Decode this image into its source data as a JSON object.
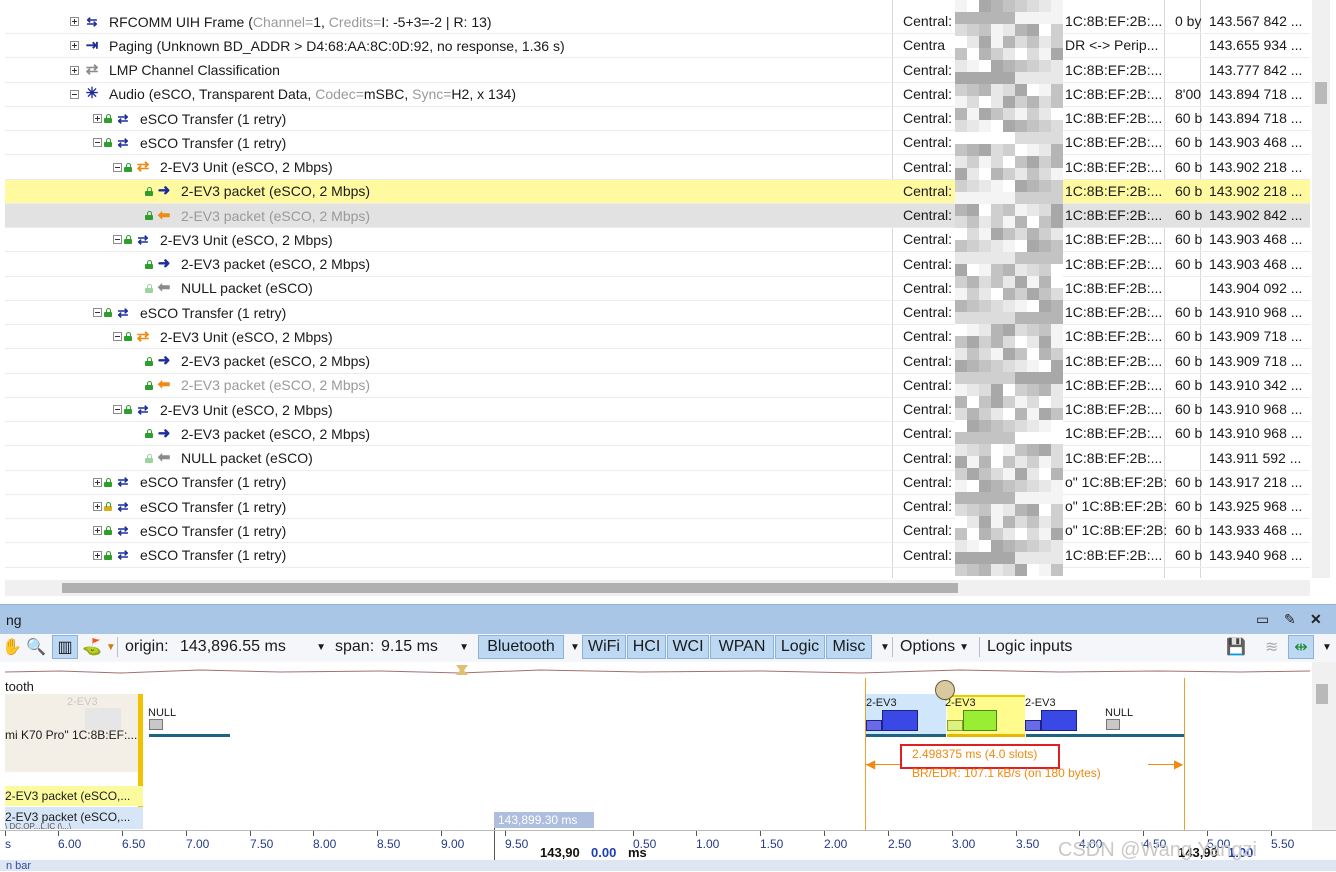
{
  "packet_rows": [
    {
      "indent": 0,
      "expander": "plus",
      "icon": "rfcomm-icon",
      "icon_glyph": "⇆",
      "icon_class": "wide swap",
      "segments": [
        {
          "t": "RFCOMM UIH Frame ("
        },
        {
          "t": "Channel=",
          "faint": true
        },
        {
          "t": "1, "
        },
        {
          "t": "Credits=",
          "faint": true
        },
        {
          "t": "I: -5+3=-2 | R: 13)"
        }
      ],
      "src": "Central:",
      "dst": "1C:8B:EF:2B:...",
      "len": "0 by",
      "time": "143.567 842 ..."
    },
    {
      "indent": 0,
      "expander": "plus",
      "icon": "paging-icon",
      "icon_glyph": "⇥",
      "icon_class": "wide blue",
      "segments": [
        {
          "t": "Paging (Unknown BD_ADDR > D4:68:AA:8C:0D:92, no response, 1.36 s)"
        }
      ],
      "src": "Centra",
      "dst": "DR <-> Perip...",
      "len": "",
      "time": "143.655 934 ..."
    },
    {
      "indent": 0,
      "expander": "plus",
      "icon": "lmp-icon",
      "icon_glyph": "⇄",
      "icon_class": "wide grey",
      "segments": [
        {
          "t": "LMP Channel Classification"
        }
      ],
      "src": "Central:",
      "dst": "1C:8B:EF:2B:...",
      "len": "",
      "time": "143.777 842 ..."
    },
    {
      "indent": 0,
      "expander": "minus",
      "icon": "audio-icon",
      "icon_glyph": "✳",
      "icon_class": "wide blue",
      "segments": [
        {
          "t": "Audio (eSCO, Transparent Data, "
        },
        {
          "t": "Codec=",
          "faint": true
        },
        {
          "t": "mSBC, "
        },
        {
          "t": "Sync=",
          "faint": true
        },
        {
          "t": "H2, x 134)"
        }
      ],
      "src": "Central:",
      "dst": "1C:8B:EF:2B:...",
      "len": "8'00",
      "time": "143.894 718 ..."
    },
    {
      "indent": 1,
      "expander": "plus",
      "lock": "green",
      "icon": "esco-transfer-icon",
      "icon_glyph": "⇄",
      "icon_class": "swap",
      "segments": [
        {
          "t": "eSCO Transfer (1 retry)"
        }
      ],
      "src": "Central:",
      "dst": "1C:8B:EF:2B:...",
      "len": "60 b",
      "time": "143.894 718 ..."
    },
    {
      "indent": 1,
      "expander": "minus",
      "lock": "green",
      "icon": "esco-transfer-icon",
      "icon_glyph": "⇄",
      "icon_class": "swap",
      "segments": [
        {
          "t": "eSCO Transfer (1 retry)"
        }
      ],
      "src": "Central:",
      "dst": "1C:8B:EF:2B:...",
      "len": "60 b",
      "time": "143.903 468 ..."
    },
    {
      "indent": 2,
      "expander": "minus",
      "lock": "green",
      "icon": "unit-icon",
      "icon_glyph": "⇄",
      "icon_class": "orange",
      "segments": [
        {
          "t": "2-EV3 Unit (eSCO, 2 Mbps)"
        }
      ],
      "src": "Central:",
      "dst": "1C:8B:EF:2B:...",
      "len": "60 b",
      "time": "143.902 218 ..."
    },
    {
      "indent": 3,
      "expander": "none",
      "lock": "green",
      "icon": "arrow-right-icon",
      "icon_glyph": "➜",
      "icon_class": "blue",
      "selected": true,
      "segments": [
        {
          "t": "2-EV3 packet (eSCO, 2 Mbps)"
        }
      ],
      "src": "Central:",
      "dst": "1C:8B:EF:2B:...",
      "len": "60 b",
      "time": "143.902 218 ..."
    },
    {
      "indent": 3,
      "expander": "none",
      "lock": "green",
      "icon": "arrow-left-icon",
      "icon_glyph": "⬅",
      "icon_class": "orange",
      "dim": true,
      "segments": [
        {
          "t": "2-EV3 packet (eSCO, 2 Mbps)"
        }
      ],
      "src": "Central:",
      "dst": "1C:8B:EF:2B:...",
      "len": "60 b",
      "time": "143.902 842 ..."
    },
    {
      "indent": 2,
      "expander": "minus",
      "lock": "green",
      "icon": "unit-icon",
      "icon_glyph": "⇄",
      "icon_class": "swap",
      "segments": [
        {
          "t": "2-EV3 Unit (eSCO, 2 Mbps)"
        }
      ],
      "src": "Central:",
      "dst": "1C:8B:EF:2B:...",
      "len": "60 b",
      "time": "143.903 468 ..."
    },
    {
      "indent": 3,
      "expander": "none",
      "lock": "green",
      "icon": "arrow-right-icon",
      "icon_glyph": "➜",
      "icon_class": "blue",
      "segments": [
        {
          "t": "2-EV3 packet (eSCO, 2 Mbps)"
        }
      ],
      "src": "Central:",
      "dst": "1C:8B:EF:2B:...",
      "len": "60 b",
      "time": "143.903 468 ..."
    },
    {
      "indent": 3,
      "expander": "none",
      "lock": "pale",
      "icon": "arrow-left-grey-icon",
      "icon_glyph": "⬅",
      "icon_class": "grey",
      "segments": [
        {
          "t": "NULL packet (eSCO)"
        }
      ],
      "src": "Central:",
      "dst": "1C:8B:EF:2B:...",
      "len": "",
      "time": "143.904 092 ..."
    },
    {
      "indent": 1,
      "expander": "minus",
      "lock": "green",
      "icon": "esco-transfer-icon",
      "icon_glyph": "⇄",
      "icon_class": "swap",
      "segments": [
        {
          "t": "eSCO Transfer (1 retry)"
        }
      ],
      "src": "Central:",
      "dst": "1C:8B:EF:2B:...",
      "len": "60 b",
      "time": "143.910 968 ..."
    },
    {
      "indent": 2,
      "expander": "minus",
      "lock": "green",
      "icon": "unit-icon",
      "icon_glyph": "⇄",
      "icon_class": "orange",
      "segments": [
        {
          "t": "2-EV3 Unit (eSCO, 2 Mbps)"
        }
      ],
      "src": "Central: \"",
      "dst": "1C:8B:EF:2B:...",
      "len": "60 b",
      "time": "143.909 718 ..."
    },
    {
      "indent": 3,
      "expander": "none",
      "lock": "green",
      "icon": "arrow-right-icon",
      "icon_glyph": "➜",
      "icon_class": "blue",
      "segments": [
        {
          "t": "2-EV3 packet (eSCO, 2 Mbps)"
        }
      ],
      "src": "Central: \"",
      "dst": "1C:8B:EF:2B:...",
      "len": "60 b",
      "time": "143.909 718 ..."
    },
    {
      "indent": 3,
      "expander": "none",
      "lock": "green",
      "icon": "arrow-left-icon",
      "icon_glyph": "⬅",
      "icon_class": "orange",
      "greytext": true,
      "segments": [
        {
          "t": "2-EV3 packet (eSCO, 2 Mbps)"
        }
      ],
      "src": "Central:",
      "dst": "1C:8B:EF:2B:...",
      "len": "60 b",
      "time": "143.910 342 ..."
    },
    {
      "indent": 2,
      "expander": "minus",
      "lock": "green",
      "icon": "unit-icon",
      "icon_glyph": "⇄",
      "icon_class": "swap",
      "segments": [
        {
          "t": "2-EV3 Unit (eSCO, 2 Mbps)"
        }
      ],
      "src": "Central:",
      "dst": "1C:8B:EF:2B:...",
      "len": "60 b",
      "time": "143.910 968 ..."
    },
    {
      "indent": 3,
      "expander": "none",
      "lock": "green",
      "icon": "arrow-right-icon",
      "icon_glyph": "➜",
      "icon_class": "blue",
      "segments": [
        {
          "t": "2-EV3 packet (eSCO, 2 Mbps)"
        }
      ],
      "src": "Central:",
      "dst": "1C:8B:EF:2B:...",
      "len": "60 b",
      "time": "143.910 968 ..."
    },
    {
      "indent": 3,
      "expander": "none",
      "lock": "pale",
      "icon": "arrow-left-grey-icon",
      "icon_glyph": "⬅",
      "icon_class": "grey",
      "segments": [
        {
          "t": "NULL packet (eSCO)"
        }
      ],
      "src": "Central:",
      "dst": "1C:8B:EF:2B:...",
      "len": "",
      "time": "143.911 592 ..."
    },
    {
      "indent": 1,
      "expander": "plus",
      "lock": "green",
      "icon": "esco-transfer-icon",
      "icon_glyph": "⇄",
      "icon_class": "swap",
      "segments": [
        {
          "t": "eSCO Transfer (1 retry)"
        }
      ],
      "src": "Central:",
      "dst": "o\" 1C:8B:EF:2B:...",
      "len": "60 b",
      "time": "143.917 218 ..."
    },
    {
      "indent": 1,
      "expander": "plus",
      "lock": "warn",
      "icon": "esco-transfer-icon",
      "icon_glyph": "⇄",
      "icon_class": "swap",
      "segments": [
        {
          "t": "eSCO Transfer (1 retry)"
        }
      ],
      "src": "Central:",
      "dst": "o\" 1C:8B:EF:2B:...",
      "len": "60 b",
      "time": "143.925 968 ..."
    },
    {
      "indent": 1,
      "expander": "plus",
      "lock": "green",
      "icon": "esco-transfer-icon",
      "icon_glyph": "⇄",
      "icon_class": "swap",
      "segments": [
        {
          "t": "eSCO Transfer (1 retry)"
        }
      ],
      "src": "Central:",
      "dst": "o\" 1C:8B:EF:2B:...",
      "len": "60 b",
      "time": "143.933 468 ..."
    },
    {
      "indent": 1,
      "expander": "plus",
      "lock": "green",
      "icon": "esco-transfer-icon",
      "icon_glyph": "⇄",
      "icon_class": "swap",
      "segments": [
        {
          "t": "eSCO Transfer (1 retry)"
        }
      ],
      "src": "Central:",
      "dst": "1C:8B:EF:2B:...",
      "len": "60 b",
      "time": "143.940 968 ..."
    }
  ],
  "timing": {
    "title": "ng",
    "toolbar": {
      "origin_label": "origin:",
      "origin_value": "143,896.55 ms",
      "span_label": "span:",
      "span_value": "9.15 ms",
      "filters": [
        "Bluetooth",
        "WiFi",
        "HCI",
        "WCI",
        "WPAN",
        "Logic",
        "Misc"
      ],
      "options_label": "Options",
      "logic_inputs_label": "Logic inputs"
    },
    "lane_header": "tooth",
    "device_label": "mi K70 Pro\" 1C:8B:EF:...",
    "device_ghost": "2-EV3",
    "lane_yellow_label": "2-EV3 packet (eSCO,...",
    "lane_blue_label": "2-EV3 packet (eSCO,...",
    "lane_blue_sub": "\\ DC.OP...L.IC (\\...\\",
    "packets": {
      "null_left": "NULL",
      "ev3_a": "2-EV3",
      "ev3_b": "2-EV3",
      "ev3_c": "2-EV3",
      "null_right": "NULL"
    },
    "measure_duration": "2.498375 ms  (4.0 slots)",
    "measure_rate": "BR/EDR:  107.1 kB/s (on 180 bytes)",
    "cursor_label": "143,899.30 ms",
    "ruler_left": [
      "s",
      "6.00",
      "6.50",
      "7.00",
      "7.50",
      "8.00",
      "8.50",
      "9.00",
      "9.50"
    ],
    "ruler_right": [
      "0.50",
      "1.00",
      "1.50",
      "2.00",
      "2.50",
      "3.00",
      "3.50",
      "4.00",
      "4.50",
      "5.00",
      "5.50"
    ],
    "ruler_mid_a": "143,90",
    "ruler_mid_b": "0.00",
    "ruler_mid_unit": "ms",
    "ruler_right_a": "143,90",
    "ruler_right_b": "1.00",
    "status_text": "n bar"
  },
  "watermark": "CSDN @Wang Yangzi",
  "colors": {
    "selected_row": "#fffaa0",
    "dim_row": "#e2e2e2",
    "accent_orange": "#f08a10",
    "measure_red": "#e02020",
    "timing_title": "#a9c6e6"
  }
}
